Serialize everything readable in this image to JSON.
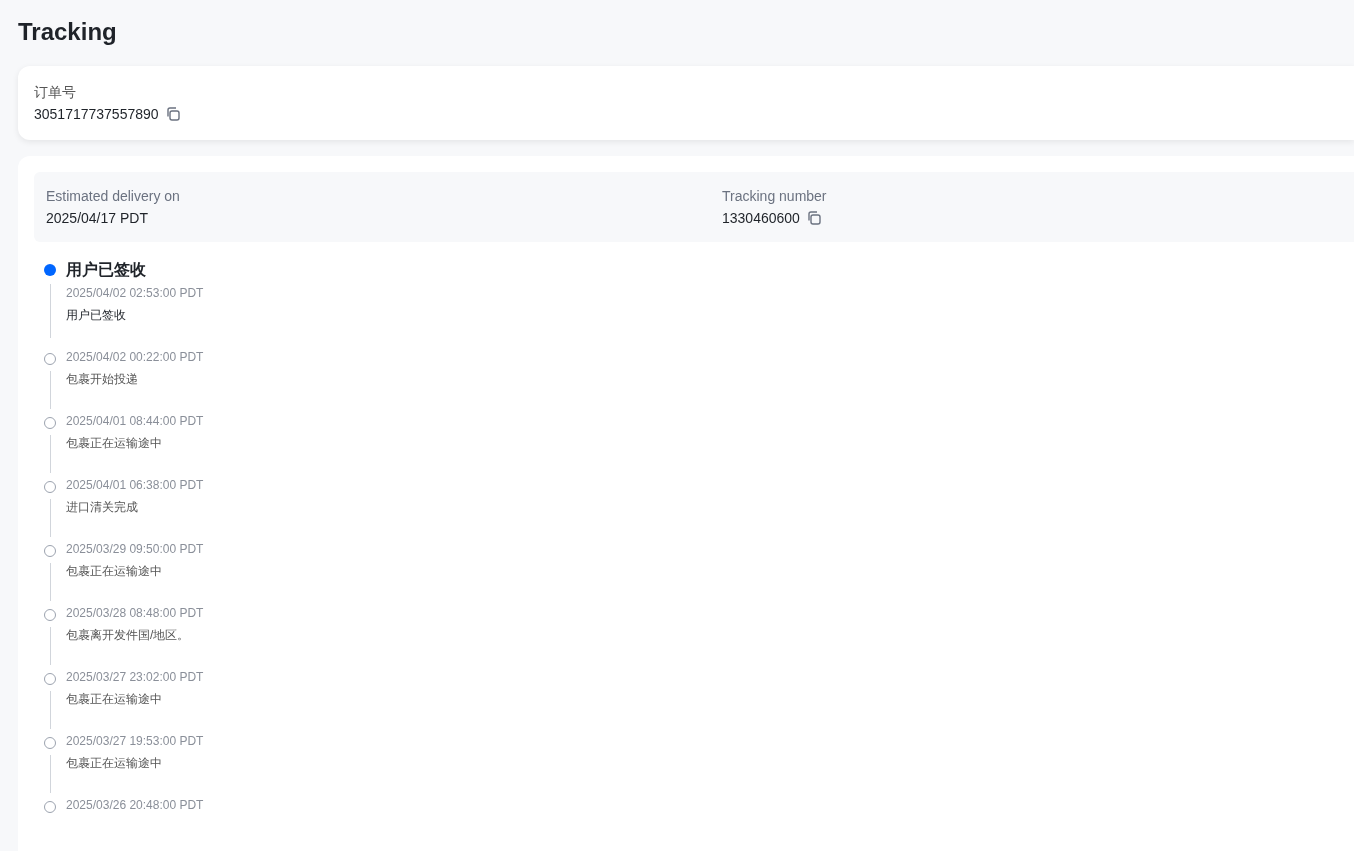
{
  "page_title": "Tracking",
  "order": {
    "label": "订单号",
    "number": "3051717737557890"
  },
  "summary": {
    "delivery_label": "Estimated delivery on",
    "delivery_date": "2025/04/17 PDT",
    "tracking_label": "Tracking number",
    "tracking_number": "1330460600"
  },
  "events": [
    {
      "current": true,
      "title": "用户已签收",
      "time": "2025/04/02 02:53:00 PDT",
      "description": "用户已签收"
    },
    {
      "current": false,
      "time": "2025/04/02 00:22:00 PDT",
      "description": "包裹开始投递"
    },
    {
      "current": false,
      "time": "2025/04/01 08:44:00 PDT",
      "description": "包裹正在运输途中"
    },
    {
      "current": false,
      "time": "2025/04/01 06:38:00 PDT",
      "description": "进口清关完成"
    },
    {
      "current": false,
      "time": "2025/03/29 09:50:00 PDT",
      "description": "包裹正在运输途中"
    },
    {
      "current": false,
      "time": "2025/03/28 08:48:00 PDT",
      "description": "包裹离开发件国/地区。"
    },
    {
      "current": false,
      "time": "2025/03/27 23:02:00 PDT",
      "description": "包裹正在运输途中"
    },
    {
      "current": false,
      "time": "2025/03/27 19:53:00 PDT",
      "description": "包裹正在运输途中"
    },
    {
      "current": false,
      "time": "2025/03/26 20:48:00 PDT"
    }
  ]
}
